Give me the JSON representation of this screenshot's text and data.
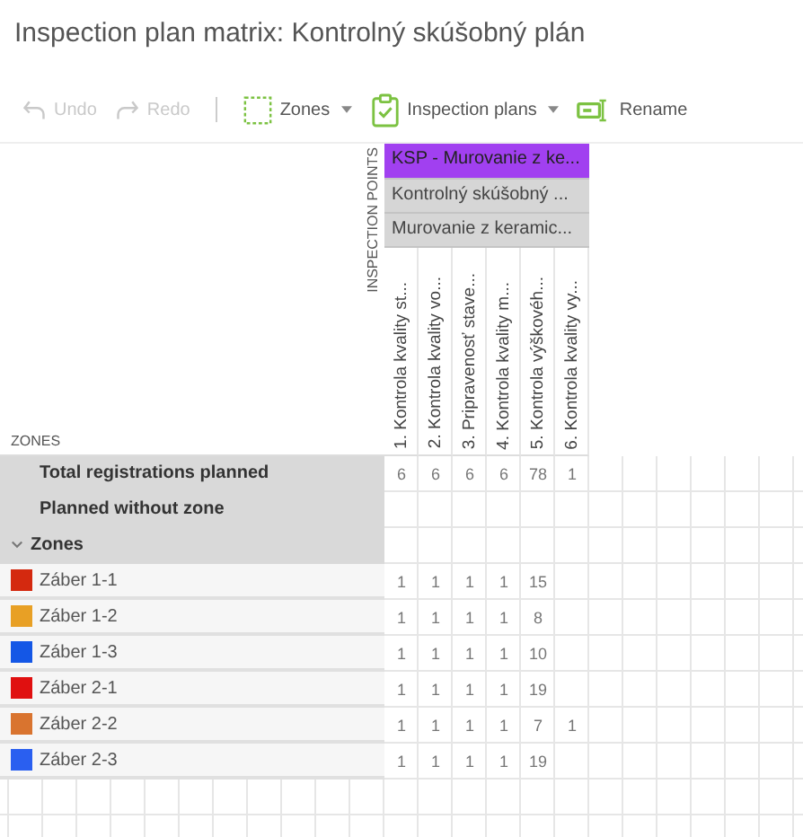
{
  "title": "Inspection plan matrix: Kontrolný skúšobný plán",
  "toolbar": [
    {
      "label": "Undo",
      "disabled": true,
      "dropdown": false
    },
    {
      "label": "Redo",
      "disabled": true,
      "dropdown": false
    },
    {
      "label": "Zones",
      "disabled": false,
      "dropdown": true
    },
    {
      "label": "Inspection plans",
      "disabled": false,
      "dropdown": true
    },
    {
      "label": "Rename",
      "disabled": false,
      "dropdown": false
    }
  ],
  "matrix": {
    "zones_heading": "ZONES",
    "points_heading": "INSPECTION POINTS",
    "plan_headers": [
      {
        "label": "KSP - Murovanie z ke...",
        "highlighted": true
      },
      {
        "label": "Kontrolný skúšobný ...",
        "highlighted": false
      },
      {
        "label": "Murovanie z keramic...",
        "highlighted": false
      }
    ],
    "columns": [
      "1. Kontrola kvality st...",
      "2. Kontrola kvality vo...",
      "3. Pripravenosť stave...",
      "4. Kontrola kvality m...",
      "5. Kontrola výškovéh...",
      "6. Kontrola kvality vy..."
    ],
    "rows": [
      {
        "kind": "summary",
        "label": "Total registrations planned",
        "values": [
          "6",
          "6",
          "6",
          "6",
          "78",
          "1"
        ]
      },
      {
        "kind": "summary",
        "label": "Planned without zone"
      },
      {
        "kind": "group",
        "label": "Zones",
        "expanded": true
      },
      {
        "kind": "zone",
        "label": "Záber 1-1",
        "color": "#d4290f",
        "values": [
          "1",
          "1",
          "1",
          "1",
          "15"
        ]
      },
      {
        "kind": "zone",
        "label": "Záber 1-2",
        "color": "#e8a025",
        "values": [
          "1",
          "1",
          "1",
          "1",
          "8"
        ]
      },
      {
        "kind": "zone",
        "label": "Záber 1-3",
        "color": "#1457e6",
        "values": [
          "1",
          "1",
          "1",
          "1",
          "10"
        ]
      },
      {
        "kind": "zone",
        "label": "Záber 2-1",
        "color": "#e01010",
        "values": [
          "1",
          "1",
          "1",
          "1",
          "19"
        ]
      },
      {
        "kind": "zone",
        "label": "Záber 2-2",
        "color": "#d9742f",
        "values": [
          "1",
          "1",
          "1",
          "1",
          "7",
          "1"
        ]
      },
      {
        "kind": "zone",
        "label": "Záber 2-3",
        "color": "#2a5ff0",
        "values": [
          "1",
          "1",
          "1",
          "1",
          "19"
        ]
      }
    ]
  }
}
